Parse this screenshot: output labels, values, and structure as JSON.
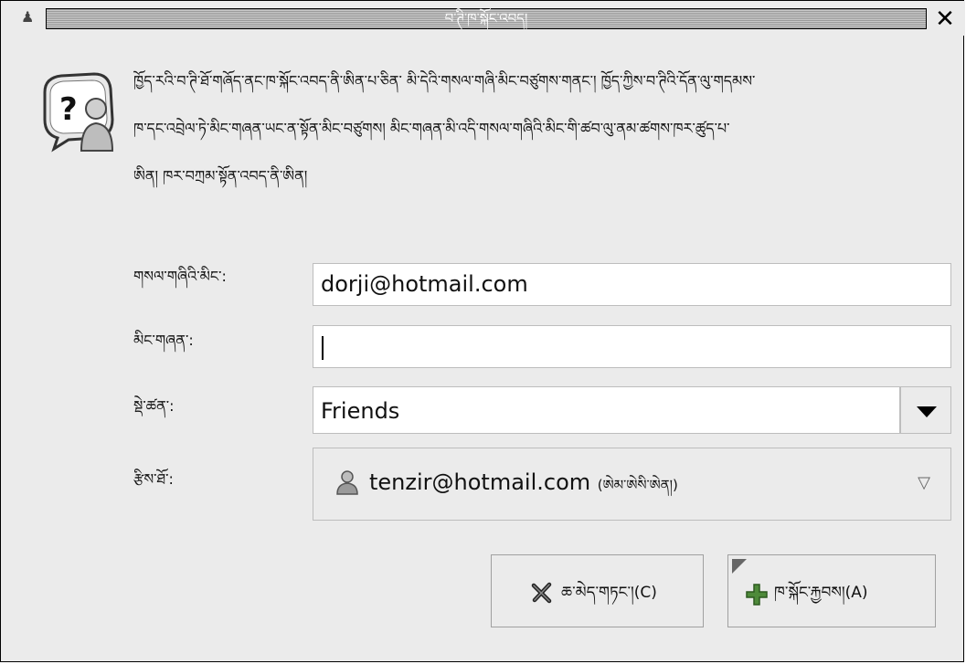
{
  "window": {
    "title": "བ་ཊི་ཁ་སྐོང་འབད།",
    "app_icon": "person-app-icon",
    "close_icon": "close-icon"
  },
  "dialog": {
    "icon": "question-person-icon",
    "message_lines": [
      "ཁྱོད་རའི་བ་ཊི་ཐོ་གཞོད་ནང་ཁ་སྐོང་འབད་ནི་ཨིན་པ་ཅིན་ མི་དེའི་གསལ་གཞི་མིང་བཙུགས་གནང་། ཁྱོད་ཀྱིས་བ་ཊིའི་དོན་ལུ་གདམས་",
      "ཁ་དང་འབྲེལ་ཏེ་མིང་གཞན་ཡང་ན་སྟོན་མིང་བཙུགས། མིང་གཞན་མི་འདི་གསལ་གཞིའི་མིང་གི་ཚབ་ལུ་ནམ་ཚགས་ཁར་ཚུད་པ་",
      "ཨིན། ཁར་བཀྲམ་སྟོན་འབད་ནི་ཨིན།"
    ]
  },
  "form": {
    "email_label": "གསལ་གཞིའི་མིང་:",
    "email_value": "dorji@hotmail.com",
    "alias_label": "མིང་གཞན་:",
    "alias_value": "",
    "group_label": "སྡེ་ཚན་:",
    "group_value": "Friends",
    "account_label": "རྩིས་ཐོ་:",
    "account_value": "tenzir@hotmail.com",
    "account_status": "(ཨེམ་ཨེསི་ཨེན།)"
  },
  "buttons": {
    "cancel_label": "ཆ་མེད་གཏང་།(C)",
    "add_label": "ཁ་སྐོང་རྐྱབས།(A)"
  },
  "colors": {
    "window_bg": "#ebebeb",
    "entry_bg": "#ffffff",
    "border": "#bdbdbd",
    "add_icon_green": "#4e8a3a"
  }
}
